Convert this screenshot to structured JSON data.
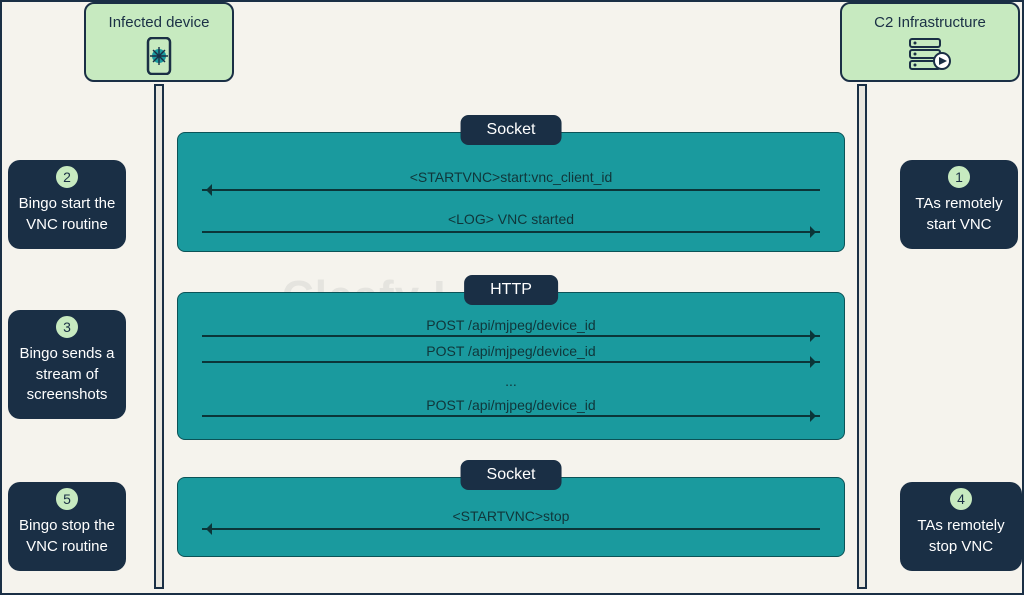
{
  "actors": {
    "left": {
      "title": "Infected device"
    },
    "right": {
      "title": "C2 Infrastructure"
    }
  },
  "steps": {
    "s1": {
      "num": "1",
      "text": "TAs remotely start VNC"
    },
    "s2": {
      "num": "2",
      "text": "Bingo start the VNC routine"
    },
    "s3": {
      "num": "3",
      "text": "Bingo sends a stream of screenshots"
    },
    "s4": {
      "num": "4",
      "text": "TAs remotely stop VNC"
    },
    "s5": {
      "num": "5",
      "text": "Bingo stop the VNC routine"
    }
  },
  "panels": {
    "p1": {
      "header": "Socket",
      "msgs": [
        "<STARTVNC>start:vnc_client_id",
        "<LOG> VNC started"
      ]
    },
    "p2": {
      "header": "HTTP",
      "msgs": [
        "POST /api/mjpeg/device_id",
        "POST /api/mjpeg/device_id",
        "...",
        "POST /api/mjpeg/device_id"
      ]
    },
    "p3": {
      "header": "Socket",
      "msgs": [
        "<STARTVNC>stop"
      ]
    }
  },
  "watermark": "Cleafy   LABS"
}
